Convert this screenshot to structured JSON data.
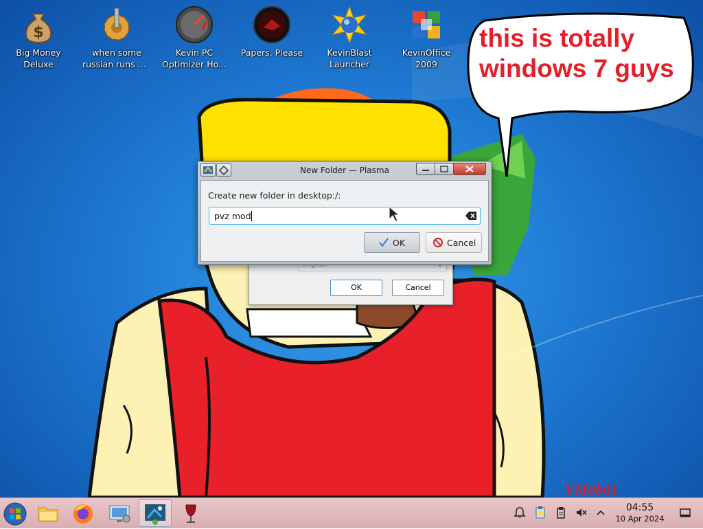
{
  "desktop_icons": [
    {
      "label_1": "Big Money",
      "label_2": "Deluxe",
      "icon": "money-bag-icon"
    },
    {
      "label_1": "when some",
      "label_2": "russian runs a...",
      "icon": "gear-icon"
    },
    {
      "label_1": "Kevin PC",
      "label_2": "Optimizer Ho...",
      "icon": "speedometer-icon"
    },
    {
      "label_1": "Papers, Please",
      "label_2": "",
      "icon": "papers-please-icon"
    },
    {
      "label_1": "KevinBlast",
      "label_2": "Launcher",
      "icon": "kevinblast-icon"
    },
    {
      "label_1": "KevinOffice",
      "label_2": "2009",
      "icon": "office-icon"
    }
  ],
  "speech_bubble": {
    "text": "this is totally windows 7 guys"
  },
  "back_dialog": {
    "combo_value": "English",
    "ok_label": "OK",
    "cancel_label": "Cancel"
  },
  "dialog": {
    "title": "New Folder — Plasma",
    "prompt": "Create new folder in desktop:/:",
    "input_value": "pvz mod",
    "ok_label": "OK",
    "cancel_label": "Cancel"
  },
  "watermark": "VM0b01",
  "taskbar": {
    "items": [
      "start-orb",
      "file-manager",
      "firefox",
      "system-settings",
      "kde-app",
      "wine"
    ],
    "clock_time": "04:55",
    "clock_date": "10 Apr 2024"
  },
  "colors": {
    "bubble_text": "#e2202a",
    "input_focus": "#3daee9",
    "taskbar": "#e3bcc0"
  }
}
